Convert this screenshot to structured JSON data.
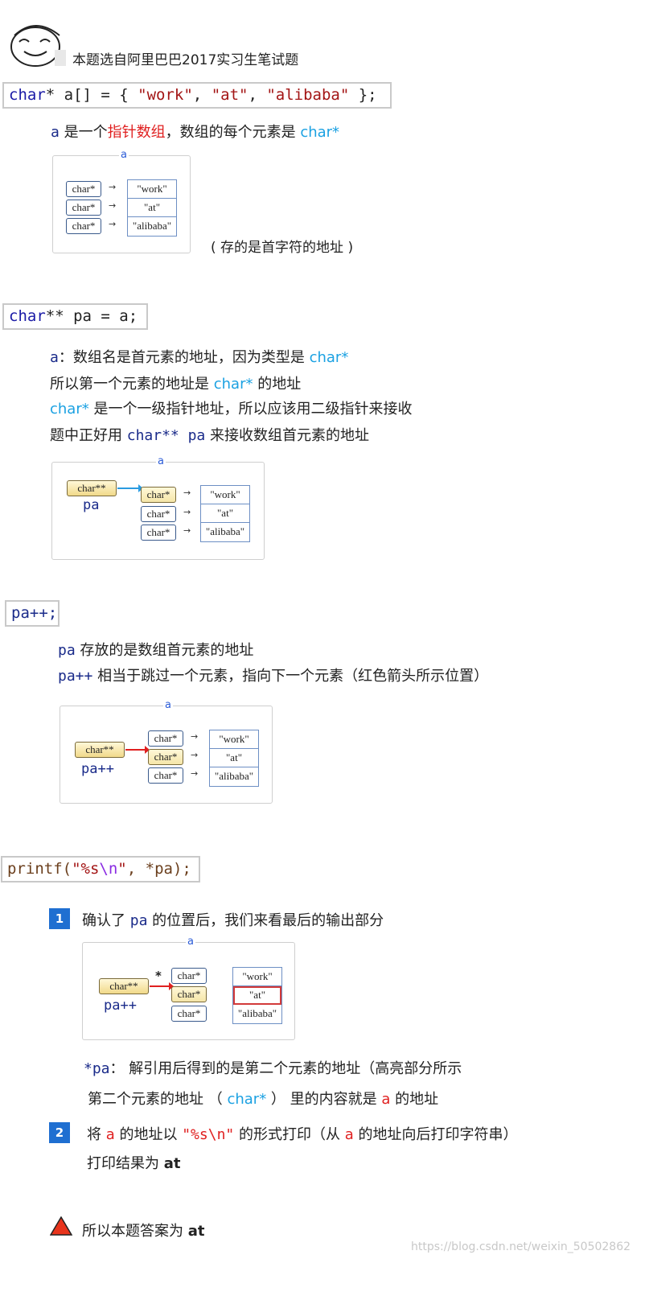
{
  "header": {
    "intro": "本题选自阿里巴巴2017实习生笔试题"
  },
  "code1": {
    "kw": "char",
    "rest": "* a[] = { ",
    "s1": "\"work\"",
    "c1": ", ",
    "s2": "\"at\"",
    "c2": ", ",
    "s3": "\"alibaba\"",
    "end": " };"
  },
  "section1": {
    "l1_a": "a",
    "l1_b": " 是一个",
    "l1_c": "指针数组",
    "l1_d": "，数组的每个元素是 ",
    "l1_e": "char*",
    "note": "( 存的是首字符的地址 )"
  },
  "diagram": {
    "label": "a",
    "ptr_cell": "char*",
    "pp_cell": "char**",
    "arrow": "→",
    "strings": [
      "\"work\"",
      "\"at\"",
      "\"alibaba\""
    ],
    "star": "*"
  },
  "code2": {
    "kw": "char",
    "rest": "** pa = a;"
  },
  "section2": {
    "l1_a": "a",
    "l1_b": "：数组名是首元素的地址，因为类型是 ",
    "l1_c": "char*",
    "l2_a": "所以第一个元素的地址是 ",
    "l2_b": "char*",
    "l2_c": " 的地址",
    "l3_a": "char*",
    "l3_b": " 是一个一级指针地址，所以应该用二级指针来接收",
    "l4_a": "题中正好用 ",
    "l4_b": "char** pa",
    "l4_c": " 来接收数组首元素的地址",
    "pa_label": "pa"
  },
  "code3": {
    "text": "pa++;"
  },
  "section3": {
    "l1_a": "pa",
    "l1_b": " 存放的是数组首元素的地址",
    "l2_a": "pa++",
    "l2_b": " 相当于跳过一个元素，指向下一个元素（红色箭头所示位置）",
    "pa_label": "pa++"
  },
  "code4": {
    "fn": "printf(",
    "fmt": "\"%s",
    "esc": "\\n",
    "q": "\"",
    "rest": ", *pa);"
  },
  "section4": {
    "b1": "1",
    "s1_a": "确认了 ",
    "s1_b": "pa",
    "s1_c": " 的位置后，我们来看最后的输出部分",
    "d1_a": "*pa",
    "d1_b": "： 解引用后得到的是第二个元素的地址（高亮部分所示",
    "d2_a": "第二个元素的地址 （ ",
    "d2_b": "char*",
    "d2_c": " ） 里的内容就是 ",
    "d2_d": "a",
    "d2_e": " 的地址",
    "b2": "2",
    "s2_a": "将 ",
    "s2_b": "a",
    "s2_c": " 的地址以 ",
    "s2_d": "\"%s\\n\"",
    "s2_e": " 的形式打印（从 ",
    "s2_f": "a",
    "s2_g": " 的地址向后打印字符串）",
    "s2_h": "打印结果为 ",
    "s2_i": "at",
    "pa_label": "pa++"
  },
  "conclusion": {
    "a": "所以本题答案为 ",
    "b": "at"
  },
  "watermark": "https://blog.csdn.net/weixin_50502862"
}
